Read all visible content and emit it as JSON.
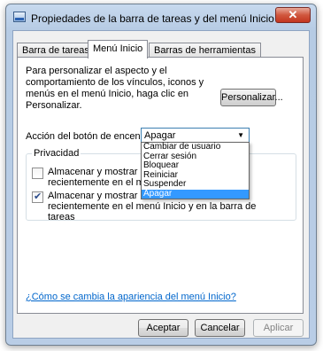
{
  "window": {
    "title": "Propiedades de la barra de tareas y del menú Inicio",
    "close_glyph": "✕"
  },
  "tabs": [
    {
      "label": "Barra de tareas",
      "active": false
    },
    {
      "label": "Menú Inicio",
      "active": true
    },
    {
      "label": "Barras de herramientas",
      "active": false
    }
  ],
  "panel": {
    "description": "Para personalizar el aspecto y el comportamiento de los vínculos, iconos y menús en el menú Inicio, haga clic en Personalizar.",
    "customize_button": "Personalizar...",
    "power_button_label": "Acción del botón de encendido:",
    "power_button_value": "Apagar",
    "dropdown_options": [
      "Cambiar de usuario",
      "Cerrar sesión",
      "Bloquear",
      "Reiniciar",
      "Suspender",
      "Apagar"
    ],
    "dropdown_selected": "Apagar",
    "privacy": {
      "title": "Privacidad",
      "option1_label": "Almacenar y mostrar programas abiertos recientemente en el menú Inicio",
      "option1_checked": false,
      "option2_label": "Almacenar y mostrar elementos abiertos recientemente en el menú Inicio y en la barra de tareas",
      "option2_checked": true
    },
    "help_link": "¿Cómo se cambia la apariencia del menú Inicio?"
  },
  "footer": {
    "accept": "Aceptar",
    "cancel": "Cancelar",
    "apply": "Aplicar"
  }
}
